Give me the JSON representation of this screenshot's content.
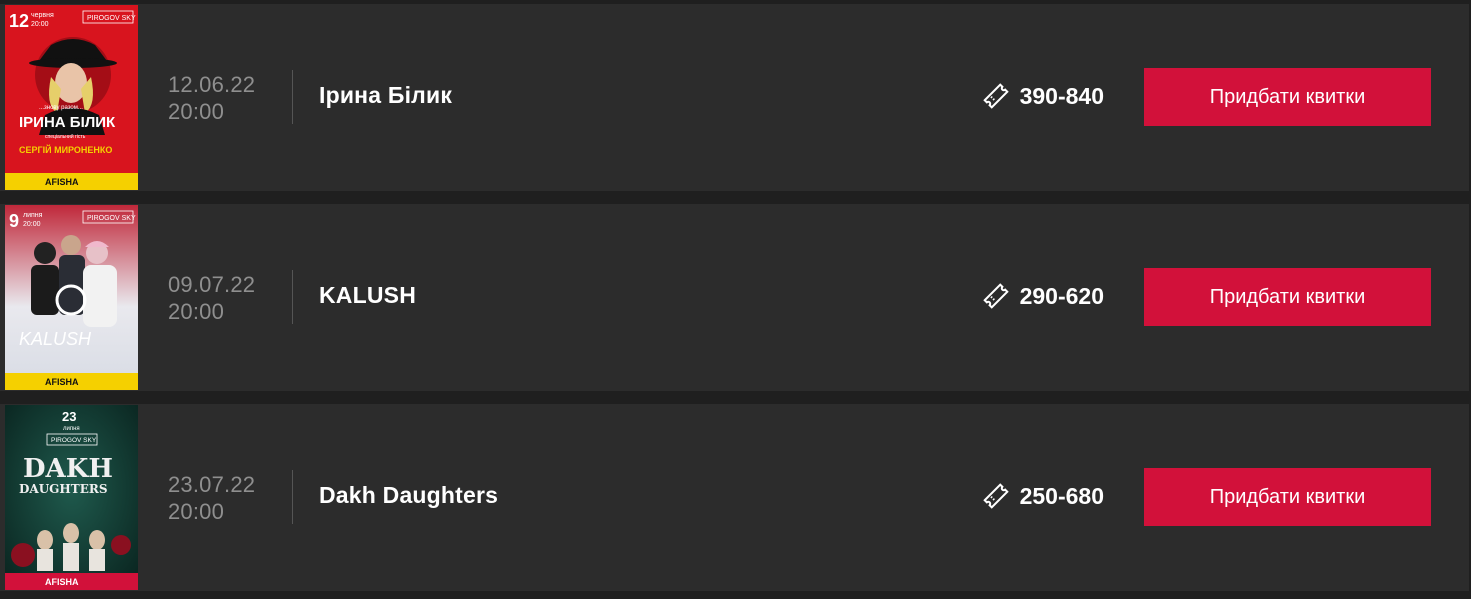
{
  "events": [
    {
      "date": "12.06.22",
      "time": "20:00",
      "title": "Ірина Білик",
      "price": "390-840",
      "button_label": "Придбати квитки",
      "poster": {
        "day": "12",
        "month": "червня",
        "time": "20:00",
        "venue": "PIROGOV SKY",
        "tagline": "...знову разом...",
        "headliner": "ІРИНА БІЛИК",
        "guest_label": "спеціальний гість",
        "guest": "СЕРГІЙ МИРОНЕНКО",
        "footer": "AFISHA",
        "background": "#d8141e",
        "accent": "#f5d000"
      }
    },
    {
      "date": "09.07.22",
      "time": "20:00",
      "title": "KALUSH",
      "price": "290-620",
      "button_label": "Придбати квитки",
      "poster": {
        "day": "9",
        "month": "липня",
        "time": "20:00",
        "venue": "PIROGOV SKY",
        "headliner": "KALUSH",
        "footer": "AFISHA",
        "background": "#b8202f",
        "accent": "#f5d000"
      }
    },
    {
      "date": "23.07.22",
      "time": "20:00",
      "title": "Dakh Daughters",
      "price": "250-680",
      "button_label": "Придбати квитки",
      "poster": {
        "day": "23",
        "month": "липня",
        "venue": "PIROGOV SKY",
        "headliner": "DAKH",
        "headliner_2": "DAUGHTERS",
        "footer": "AFISHA",
        "background": "#0f3b33",
        "accent": "#d2113a"
      }
    }
  ],
  "icons": {
    "price": "ticket-icon"
  },
  "colors": {
    "button": "#d2113a",
    "row_background": "#2c2c2c",
    "page_background": "#1f1f1f",
    "date_text": "#8f8f8f"
  }
}
